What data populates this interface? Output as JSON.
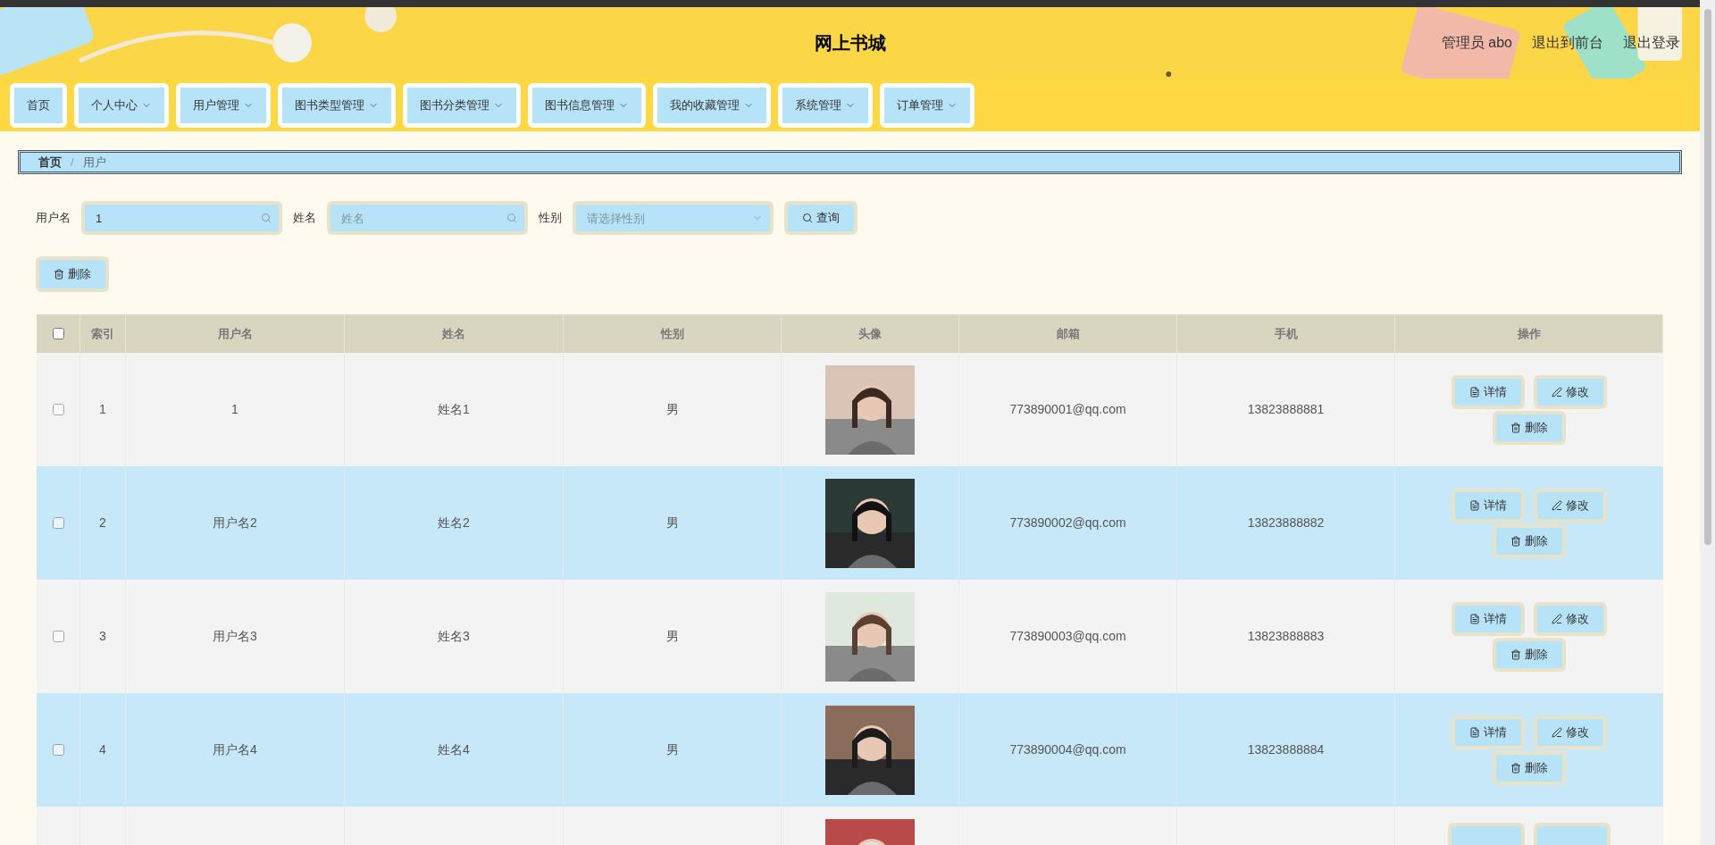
{
  "header": {
    "title": "网上书城",
    "links": [
      "管理员 abo",
      "退出到前台",
      "退出登录"
    ]
  },
  "nav": [
    {
      "label": "首页",
      "dropdown": false
    },
    {
      "label": "个人中心",
      "dropdown": true
    },
    {
      "label": "用户管理",
      "dropdown": true
    },
    {
      "label": "图书类型管理",
      "dropdown": true
    },
    {
      "label": "图书分类管理",
      "dropdown": true
    },
    {
      "label": "图书信息管理",
      "dropdown": true
    },
    {
      "label": "我的收藏管理",
      "dropdown": true
    },
    {
      "label": "系统管理",
      "dropdown": true
    },
    {
      "label": "订单管理",
      "dropdown": true
    }
  ],
  "breadcrumb": {
    "items": [
      "首页",
      "用户"
    ],
    "separator": "/"
  },
  "filters": [
    {
      "kind": "text",
      "label": "用户名",
      "value": "1"
    },
    {
      "kind": "text",
      "label": "姓名",
      "placeholder": "姓名"
    },
    {
      "kind": "select",
      "label": "性别",
      "placeholder": "请选择性别"
    }
  ],
  "search_button": "查询",
  "delete_button": "删除",
  "table": {
    "select_all_checked": false,
    "columns": [
      "索引",
      "用户名",
      "姓名",
      "性别",
      "头像",
      "邮箱",
      "手机",
      "操作"
    ],
    "rows": [
      {
        "checked": false,
        "index": "1",
        "username": "1",
        "name": "姓名1",
        "gender": "男",
        "email": "773890001@qq.com",
        "phone": "13823888881",
        "actions": [
          "详情",
          "修改",
          "删除"
        ]
      },
      {
        "checked": false,
        "index": "2",
        "username": "用户名2",
        "name": "姓名2",
        "gender": "男",
        "email": "773890002@qq.com",
        "phone": "13823888882",
        "actions": [
          "详情",
          "修改",
          "删除"
        ]
      },
      {
        "checked": false,
        "index": "3",
        "username": "用户名3",
        "name": "姓名3",
        "gender": "男",
        "email": "773890003@qq.com",
        "phone": "13823888883",
        "actions": [
          "详情",
          "修改",
          "删除"
        ]
      },
      {
        "checked": false,
        "index": "4",
        "username": "用户名4",
        "name": "姓名4",
        "gender": "男",
        "email": "773890004@qq.com",
        "phone": "13823888884",
        "actions": [
          "详情",
          "修改",
          "删除"
        ]
      },
      {
        "kind": "cut"
      }
    ]
  }
}
